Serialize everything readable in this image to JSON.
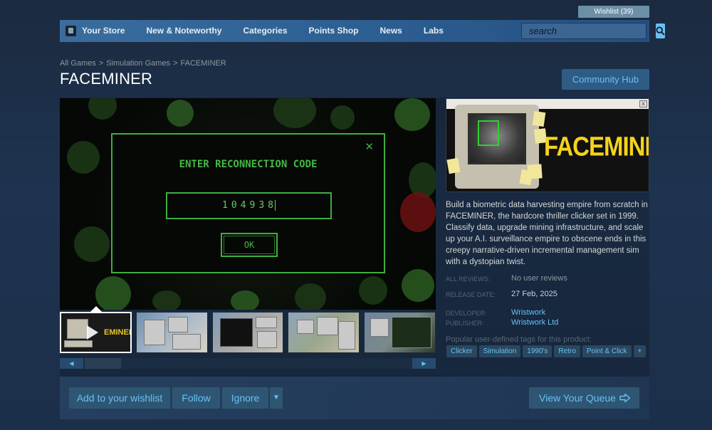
{
  "header": {
    "wishlist_label": "Wishlist (39)"
  },
  "nav": {
    "items": [
      {
        "label": "Your Store"
      },
      {
        "label": "New & Noteworthy"
      },
      {
        "label": "Categories"
      },
      {
        "label": "Points Shop"
      },
      {
        "label": "News"
      },
      {
        "label": "Labs"
      }
    ],
    "search_placeholder": "search"
  },
  "breadcrumb": [
    "All Games",
    "Simulation Games",
    "FACEMINER"
  ],
  "breadcrumb_sep": ">",
  "page": {
    "title": "FACEMINER",
    "community_hub_label": "Community Hub"
  },
  "screenshot": {
    "dialog_title": "ENTER RECONNECTION CODE",
    "close_glyph": "✕",
    "code_value": "104938",
    "ok_label": "OK"
  },
  "thumbnails": {
    "first_label": "EMINER"
  },
  "slider": {
    "left_glyph": "◀",
    "right_glyph": "▶"
  },
  "capsule": {
    "title": "FACEMINER",
    "close_glyph": "x"
  },
  "description": "Build a biometric data harvesting empire from scratch in FACEMINER, the hardcore thriller clicker set in 1999. Classify data, upgrade mining infrastructure, and scale up your A.I. surveillance empire to obscene ends in this creepy narrative-driven incremental management sim with a dystopian twist.",
  "info": {
    "reviews_label": "ALL REVIEWS:",
    "reviews_value": "No user reviews",
    "release_label": "RELEASE DATE:",
    "release_value": "27 Feb, 2025",
    "developer_label": "DEVELOPER:",
    "developer_value": "Wristwork",
    "publisher_label": "PUBLISHER:",
    "publisher_value": "Wristwork Ltd"
  },
  "tags": {
    "label": "Popular user-defined tags for this product:",
    "items": [
      "Clicker",
      "Simulation",
      "1990's",
      "Retro",
      "Point & Click",
      "+"
    ]
  },
  "actions": {
    "wishlist_label": "Add to your wishlist",
    "follow_label": "Follow",
    "ignore_label": "Ignore",
    "ignore_dropdown_glyph": "▼",
    "queue_label": "View Your Queue"
  },
  "colors": {
    "accent": "#67c1f5",
    "terminal_green": "#3fae3f",
    "capsule_yellow": "#f5d21c"
  }
}
